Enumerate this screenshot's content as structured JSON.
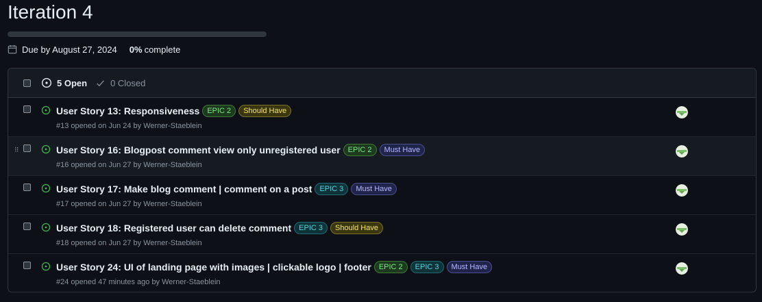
{
  "milestone": {
    "title": "Iteration 4",
    "progress_fraction": 0,
    "due_text": "Due by August 27, 2024",
    "percent": "0%",
    "percent_suffix": "complete"
  },
  "header": {
    "open_label": "5 Open",
    "closed_label": "0 Closed"
  },
  "colors": {
    "open_icon": "#3fb950",
    "epic2": "#7ee787",
    "epic3": "#56d4dd",
    "should_have": "#f5e663",
    "must_have": "#b4b9ff"
  },
  "issues": [
    {
      "title": "User Story 13: Responsiveness",
      "labels": [
        {
          "text": "EPIC 2",
          "kind": "epic2"
        },
        {
          "text": "Should Have",
          "kind": "should"
        }
      ],
      "meta": "#13 opened on Jun 24 by Werner-Staeblein",
      "avatar_icon": "avatar-icon"
    },
    {
      "title": "User Story 16: Blogpost comment view only unregistered user",
      "labels": [
        {
          "text": "EPIC 2",
          "kind": "epic2"
        },
        {
          "text": "Must Have",
          "kind": "must"
        }
      ],
      "meta": "#16 opened on Jun 27 by Werner-Staeblein",
      "avatar_icon": "avatar-icon"
    },
    {
      "title": "User Story 17: Make blog comment | comment on a post",
      "labels": [
        {
          "text": "EPIC 3",
          "kind": "epic3"
        },
        {
          "text": "Must Have",
          "kind": "must"
        }
      ],
      "meta": "#17 opened on Jun 27 by Werner-Staeblein",
      "avatar_icon": "avatar-icon"
    },
    {
      "title": "User Story 18: Registered user can delete comment",
      "labels": [
        {
          "text": "EPIC 3",
          "kind": "epic3"
        },
        {
          "text": "Should Have",
          "kind": "should"
        }
      ],
      "meta": "#18 opened on Jun 27 by Werner-Staeblein",
      "avatar_icon": "avatar-icon"
    },
    {
      "title": "User Story 24: UI of landing page with images | clickable logo | footer",
      "labels": [
        {
          "text": "EPIC 2",
          "kind": "epic2"
        },
        {
          "text": "EPIC 3",
          "kind": "epic3"
        },
        {
          "text": "Must Have",
          "kind": "must"
        }
      ],
      "meta": "#24 opened 47 minutes ago by Werner-Staeblein",
      "avatar_icon": "avatar-icon"
    }
  ]
}
